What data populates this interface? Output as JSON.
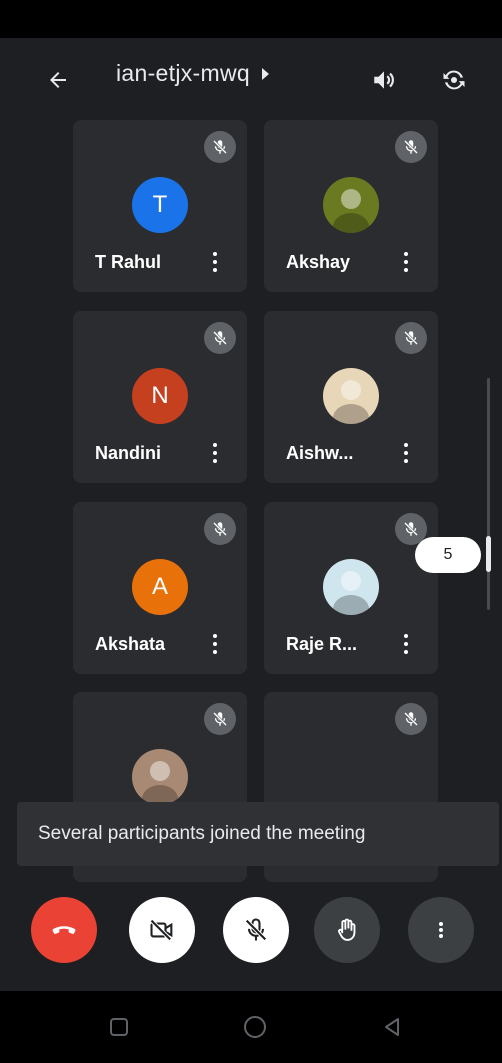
{
  "header": {
    "meeting_code": "ian-etjx-mwq"
  },
  "participants": [
    {
      "name": "T Rahul",
      "initial": "T",
      "color": "#1a73e8",
      "photo": false
    },
    {
      "name": "Akshay",
      "initial": "",
      "color": "#6a7a20",
      "photo": true
    },
    {
      "name": "Nandini",
      "initial": "N",
      "color": "#c5401f",
      "photo": false
    },
    {
      "name": "Aishw...",
      "initial": "",
      "color": "#e8d6b8",
      "photo": true
    },
    {
      "name": "Akshata",
      "initial": "A",
      "color": "#e8710a",
      "photo": false
    },
    {
      "name": "Raje R...",
      "initial": "",
      "color": "#cfe6ef",
      "photo": true
    },
    {
      "name": "",
      "initial": "",
      "color": "#a88a74",
      "photo": true
    },
    {
      "name": "",
      "initial": "",
      "color": "",
      "photo": false
    }
  ],
  "page_indicator": "5",
  "toast": {
    "message": "Several participants joined the meeting"
  },
  "controls": {
    "end_call_color": "#ea4335"
  }
}
